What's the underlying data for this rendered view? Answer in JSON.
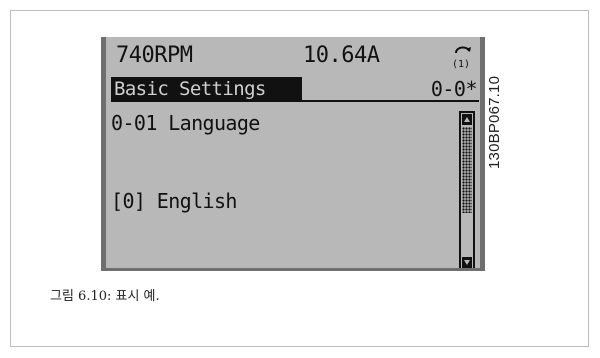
{
  "display": {
    "status": {
      "rpm": "740RPM",
      "current": "10.64A",
      "menu_indicator": "(1)"
    },
    "header": {
      "title": "Basic Settings",
      "code": "0-0*"
    },
    "parameter": {
      "name": "0-01 Language",
      "value": "[0] English"
    },
    "scrollbar": {
      "position_fraction": 0.0,
      "visible_fraction": 0.6
    }
  },
  "figure": {
    "side_code": "130BP067.10",
    "caption": "그림 6.10: 표시 예."
  },
  "icons": {
    "menu": "menu-set-icon",
    "scroll_up": "arrow-up-icon",
    "scroll_down": "arrow-down-icon"
  }
}
